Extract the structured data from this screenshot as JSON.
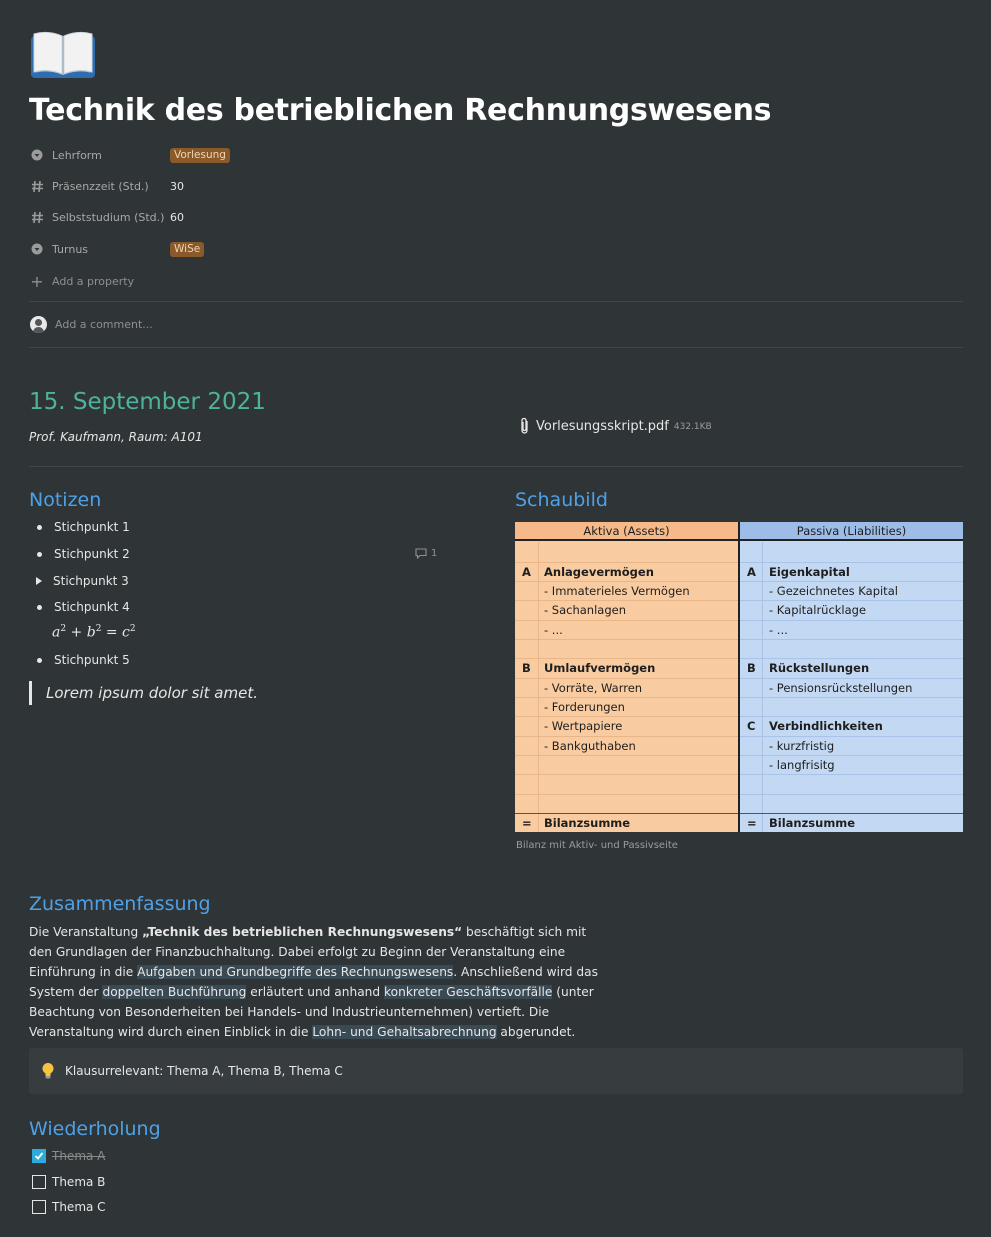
{
  "page": {
    "icon": "open-book-icon",
    "title": "Technik des betrieblichen Rechnungswesens"
  },
  "properties": [
    {
      "icon": "select-icon",
      "label": "Lehrform",
      "value": "Vorlesung",
      "type": "tag"
    },
    {
      "icon": "number-icon",
      "label": "Präsenzzeit (Std.)",
      "value": "30",
      "type": "number"
    },
    {
      "icon": "number-icon",
      "label": "Selbststudium (Std.)",
      "value": "60",
      "type": "number"
    },
    {
      "icon": "select-icon",
      "label": "Turnus",
      "value": "WiSe",
      "type": "tag"
    }
  ],
  "add_property": "Add a property",
  "comment_placeholder": "Add a comment...",
  "session": {
    "date": "15. September 2021",
    "info": "Prof. Kaufmann, Raum: A101",
    "file_name": "Vorlesungsskript.pdf",
    "file_size": "432.1KB"
  },
  "notes": {
    "heading": "Notizen",
    "items": [
      "Stichpunkt 1",
      "Stichpunkt 2",
      "Stichpunkt 3",
      "Stichpunkt 4",
      "Stichpunkt 5"
    ],
    "comment_count": "1",
    "quote": "Lorem ipsum dolor sit amet."
  },
  "diagram": {
    "heading": "Schaubild",
    "aktiva_header": "Aktiva (Assets)",
    "passiva_header": "Passiva (Liabilities)",
    "aktiva": {
      "a_letter": "A",
      "a_title": "Anlagevermögen",
      "a_items": [
        "- Immaterieles Vermögen",
        "- Sachanlagen",
        "- ..."
      ],
      "b_letter": "B",
      "b_title": "Umlaufvermögen",
      "b_items": [
        "- Vorräte, Warren",
        "- Forderungen",
        "- Wertpapiere",
        "- Bankguthaben"
      ],
      "sum_letter": "=",
      "sum": "Bilanzsumme"
    },
    "passiva": {
      "a_letter": "A",
      "a_title": "Eigenkapital",
      "a_items": [
        "- Gezeichnetes Kapital",
        "- Kapitalrücklage",
        "- ..."
      ],
      "b_letter": "B",
      "b_title": "Rückstellungen",
      "b_items": [
        "- Pensionsrückstellungen"
      ],
      "c_letter": "C",
      "c_title": "Verbindlichkeiten",
      "c_items": [
        "- kurzfristig",
        "- langfrisitg"
      ],
      "sum_letter": "=",
      "sum": "Bilanzsumme"
    },
    "caption": "Bilanz mit Aktiv- und Passivseite"
  },
  "summary": {
    "heading": "Zusammenfassung",
    "p1": "Die Veranstaltung ",
    "bold": "„Technik des betrieblichen Rechnungswesens“",
    "p2": " beschäftigt sich mit den Grundlagen der Finanzbuchhaltung. Dabei erfolgt zu Beginn der Veranstaltung eine Einführung in die ",
    "hl1": "Aufgaben und Grundbegriffe des Rechnungswesens",
    "p3": ". Anschließend wird das System der ",
    "hl2": "doppelten Buchführung",
    "p4": " erläutert und anhand ",
    "hl3": "konkreter Geschäftsvorfälle",
    "p5": " (unter Beachtung von Besonderheiten bei Handels- und Industrieunternehmen) vertieft. Die Veranstaltung wird durch einen Einblick in die ",
    "hl4": "Lohn- und Gehaltsabrechnung",
    "p6": " abgerundet.",
    "callout_icon": "lightbulb-icon",
    "callout": "Klausurrelevant: Thema A, Thema B, Thema C"
  },
  "review": {
    "heading": "Wiederholung",
    "todos": [
      {
        "label": "Thema A",
        "checked": true
      },
      {
        "label": "Thema B",
        "checked": false
      },
      {
        "label": "Thema C",
        "checked": false
      }
    ]
  },
  "colors": {
    "background": "#2f3437",
    "date_heading": "#4db39a",
    "section_heading": "#4ea1e6",
    "tag_bg": "#8a5a2b",
    "aktiva_bg": "#f9cba0",
    "passiva_bg": "#c3d8f2",
    "checkbox_checked": "#2eaadc"
  }
}
